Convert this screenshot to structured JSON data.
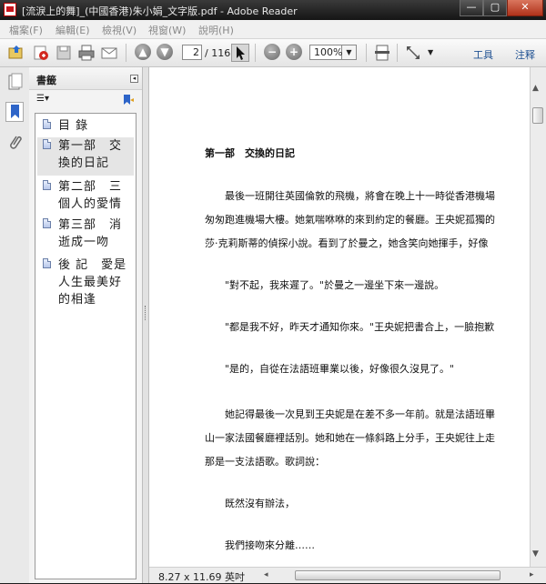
{
  "window": {
    "title": "[流淚上的舞]_(中國香港)朱小娟_文字版.pdf - Adobe Reader",
    "min_label": "—",
    "max_label": "▢",
    "close_label": "✕"
  },
  "menu": [
    "檔案(F)",
    "編輯(E)",
    "檢視(V)",
    "視窗(W)",
    "說明(H)"
  ],
  "toolbar": {
    "prev_label": "▲",
    "next_label": "▼",
    "current_page": "2",
    "total_pages": "/ 116",
    "zoom_out_label": "−",
    "zoom_in_label": "+",
    "zoom_value": "100%",
    "zoom_drop": "▼",
    "tools_label": "工具",
    "comment_label": "注释"
  },
  "panel": {
    "title": "書籤",
    "collapse": "◂",
    "options_label": "☰▾",
    "bookmarks": [
      {
        "label": "目 錄",
        "selected": false
      },
      {
        "label": "第一部　交換的日記",
        "selected": true
      },
      {
        "label": "第二部　三個人的愛情",
        "selected": false
      },
      {
        "label": "第三部　消逝成一吻",
        "selected": false
      },
      {
        "label": "後 記　愛是人生最美好的相逢",
        "selected": false
      }
    ]
  },
  "document": {
    "heading": "第一部　交換的日記",
    "lines": [
      "　　最後一班開往英國倫敦的飛機，將會在晚上十一時從香港機場",
      "匆匆跑進機場大樓。她氣喘咻咻的來到約定的餐廳。王央妮孤獨的",
      "莎·克莉斯蒂的偵探小說。看到了於曼之，她含笑向她揮手，好像",
      "　　\"對不起，我來遲了。\"於曼之一邊坐下來一邊說。",
      "　　\"都是我不好，昨天才通知你來。\"王央妮把書合上，一臉抱歉",
      "　　\"是的，自從在法語班畢業以後，好像很久沒見了。\"",
      "　　她記得最後一次見到王央妮是在差不多一年前。就是法語班畢",
      "山一家法國餐廳裡話別。她和她在一條斜路上分手，王央妮往上走",
      "那是一支法語歌。歌詞說：",
      "　　既然沒有辦法，",
      "　　我們接吻來分離……"
    ]
  },
  "status": {
    "page_size": "8.27 x 11.69 英吋",
    "hleft": "◂",
    "hright": "▸"
  },
  "scroll": {
    "up": "▲",
    "down": "▼"
  },
  "colors": {
    "link": "#1d4f91",
    "titlebar": "#1e1e1e",
    "close": "#c0432a"
  }
}
